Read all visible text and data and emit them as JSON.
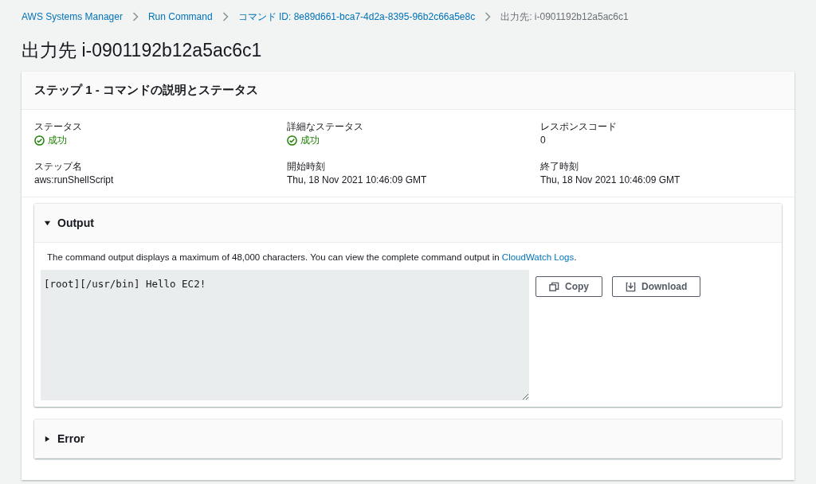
{
  "breadcrumbs": [
    {
      "label": "AWS Systems Manager",
      "link": true
    },
    {
      "label": "Run Command",
      "link": true
    },
    {
      "label": "コマンド ID: 8e89d661-bca7-4d2a-8395-96b2c66a5e8c",
      "link": true
    },
    {
      "label": "出力先: i-0901192b12a5ac6c1",
      "link": false
    }
  ],
  "title": "出力先 i-0901192b12a5ac6c1",
  "step_card": {
    "title": "ステップ 1 - コマンドの説明とステータス",
    "fields": [
      {
        "label": "ステータス",
        "value": "成功",
        "kind": "status"
      },
      {
        "label": "詳細なステータス",
        "value": "成功",
        "kind": "status"
      },
      {
        "label": "レスポンスコード",
        "value": "0",
        "kind": "text"
      },
      {
        "label": "ステップ名",
        "value": "aws:runShellScript",
        "kind": "text"
      },
      {
        "label": "開始時刻",
        "value": "Thu, 18 Nov 2021 10:46:09 GMT",
        "kind": "text"
      },
      {
        "label": "終了時刻",
        "value": "Thu, 18 Nov 2021 10:46:09 GMT",
        "kind": "text"
      }
    ]
  },
  "sections": [
    {
      "title": "Output",
      "expanded": true,
      "description": "The command output displays a maximum of 48,000 characters. You can view the complete command output in ",
      "description_link": "CloudWatch Logs",
      "description_end": ".",
      "output": "[root][/usr/bin] Hello EC2!",
      "buttons": [
        {
          "label": "Copy",
          "kind": "copy"
        },
        {
          "label": "Download",
          "kind": "download"
        }
      ]
    },
    {
      "title": "Error",
      "expanded": false
    }
  ]
}
